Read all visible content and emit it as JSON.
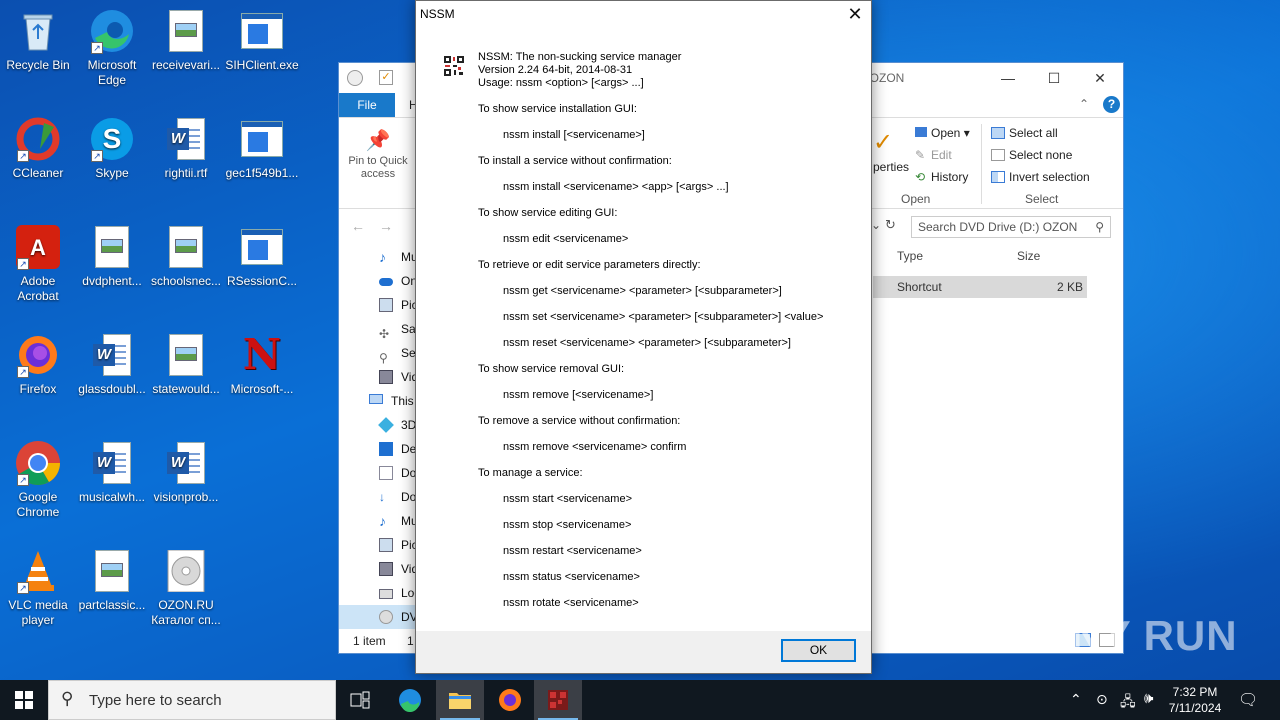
{
  "desktop": {
    "icons": [
      {
        "label": "Recycle Bin"
      },
      {
        "label": "Microsoft Edge"
      },
      {
        "label": "receivevari..."
      },
      {
        "label": "SIHClient.exe"
      },
      {
        "label": "CCleaner"
      },
      {
        "label": "Skype"
      },
      {
        "label": "rightii.rtf"
      },
      {
        "label": "gec1f549b1..."
      },
      {
        "label": "Adobe Acrobat"
      },
      {
        "label": "dvdphent..."
      },
      {
        "label": "schoolsnec..."
      },
      {
        "label": "RSessionC..."
      },
      {
        "label": "Firefox"
      },
      {
        "label": "glassdoubl..."
      },
      {
        "label": "statewould..."
      },
      {
        "label": "Microsoft-..."
      },
      {
        "label": "Google Chrome"
      },
      {
        "label": "musicalwh..."
      },
      {
        "label": "visionprob..."
      },
      {
        "label": "VLC media player"
      },
      {
        "label": "partclassic..."
      },
      {
        "label": "OZON.RU Каталог сп..."
      }
    ]
  },
  "explorer": {
    "title": ":) OZON",
    "file_tab": "File",
    "home_tab_partial": "H",
    "pin_label": "Pin to Quick access",
    "properties_partial": "perties",
    "open_label": "Open",
    "edit_label": "Edit",
    "history_label": "History",
    "open_group": "Open",
    "select_all": "Select all",
    "select_none": "Select none",
    "invert_selection": "Invert selection",
    "select_group": "Select",
    "search_placeholder": "Search DVD Drive (D:) OZON",
    "col_type": "Type",
    "col_size": "Size",
    "row_type": "Shortcut",
    "row_size": "2 KB",
    "status": "1 item",
    "status_extra": "1",
    "nav": [
      "Mu",
      "On",
      "Pic",
      "Sav",
      "Sea",
      "Vid",
      "This",
      "3D",
      "De",
      "Do",
      "Do",
      "Mu",
      "Pic",
      "Vid",
      "Loc",
      "DV"
    ]
  },
  "dialog": {
    "title": "NSSM",
    "lines": [
      "NSSM: The non-sucking service manager",
      "Version 2.24 64-bit, 2014-08-31",
      "Usage: nssm <option> [<args> ...]",
      "To show service installation GUI:",
      "nssm install [<servicename>]",
      "To install a service without confirmation:",
      "nssm install <servicename> <app> [<args> ...]",
      "To show service editing GUI:",
      "nssm edit <servicename>",
      "To retrieve or edit service parameters directly:",
      "nssm get <servicename> <parameter> [<subparameter>]",
      "nssm set <servicename> <parameter> [<subparameter>] <value>",
      "nssm reset <servicename> <parameter> [<subparameter>]",
      "To show service removal GUI:",
      "nssm remove [<servicename>]",
      "To remove a service without confirmation:",
      "nssm remove <servicename> confirm",
      "To manage a service:",
      "nssm start <servicename>",
      "nssm stop <servicename>",
      "nssm restart <servicename>",
      "nssm status <servicename>",
      "nssm rotate <servicename>"
    ],
    "ok_label": "OK"
  },
  "taskbar": {
    "search_placeholder": "Type here to search",
    "time": "7:32 PM",
    "date": "7/11/2024"
  },
  "watermark": "ANY RUN"
}
